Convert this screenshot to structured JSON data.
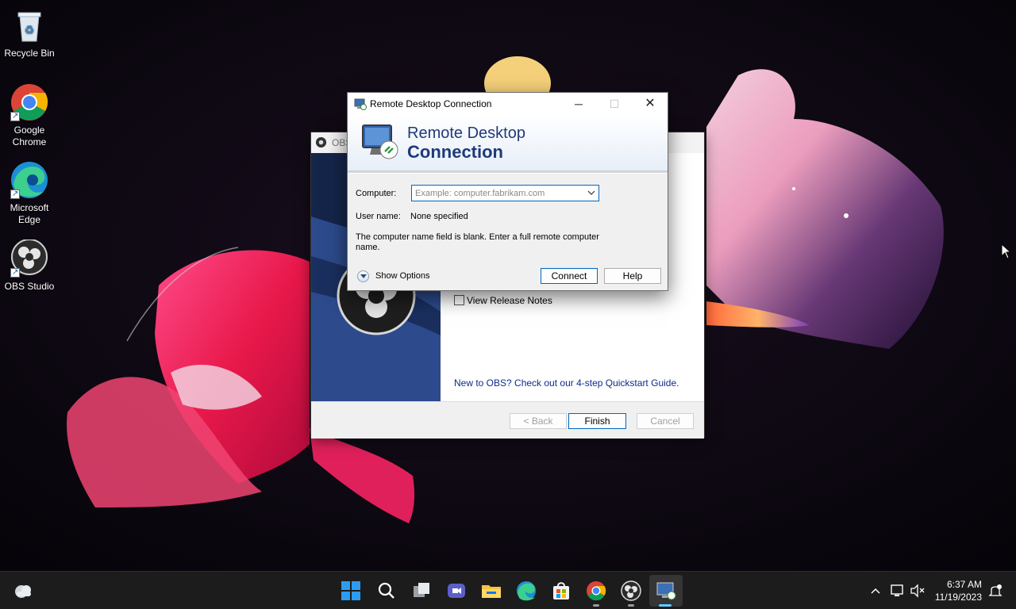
{
  "desktop": {
    "icons": [
      {
        "label": "Recycle Bin",
        "icon": "recycle-bin-icon"
      },
      {
        "label": "Google Chrome",
        "icon": "chrome-icon"
      },
      {
        "label": "Microsoft Edge",
        "icon": "edge-icon"
      },
      {
        "label": "OBS Studio",
        "icon": "obs-icon"
      }
    ]
  },
  "obs_wizard": {
    "title": "OBS",
    "view_release_notes": "View Release Notes",
    "quickstart_link": "New to OBS? Check out our 4-step Quickstart Guide.",
    "back_label": "< Back",
    "finish_label": "Finish",
    "cancel_label": "Cancel"
  },
  "rdp_dialog": {
    "title": "Remote Desktop Connection",
    "banner_line1": "Remote Desktop",
    "banner_line2": "Connection",
    "computer_label": "Computer:",
    "computer_value": "",
    "computer_placeholder": "Example: computer.fabrikam.com",
    "username_label": "User name:",
    "username_value": "None specified",
    "message": "The computer name field is blank. Enter a full remote computer name.",
    "show_options_label": "Show Options",
    "connect_label": "Connect",
    "help_label": "Help"
  },
  "taskbar": {
    "pinned": [
      "widgets-icon",
      "start-icon",
      "search-icon",
      "task-view-icon",
      "meet-icon",
      "file-explorer-icon",
      "edge-icon",
      "store-icon",
      "chrome-icon",
      "obs-icon",
      "remote-desktop-icon"
    ],
    "time": "6:37 AM",
    "date": "11/19/2023"
  },
  "colors": {
    "accent": "#0067c0",
    "taskbar": "#1c1c1c",
    "rdp_banner_text": "#1f3a7a"
  }
}
